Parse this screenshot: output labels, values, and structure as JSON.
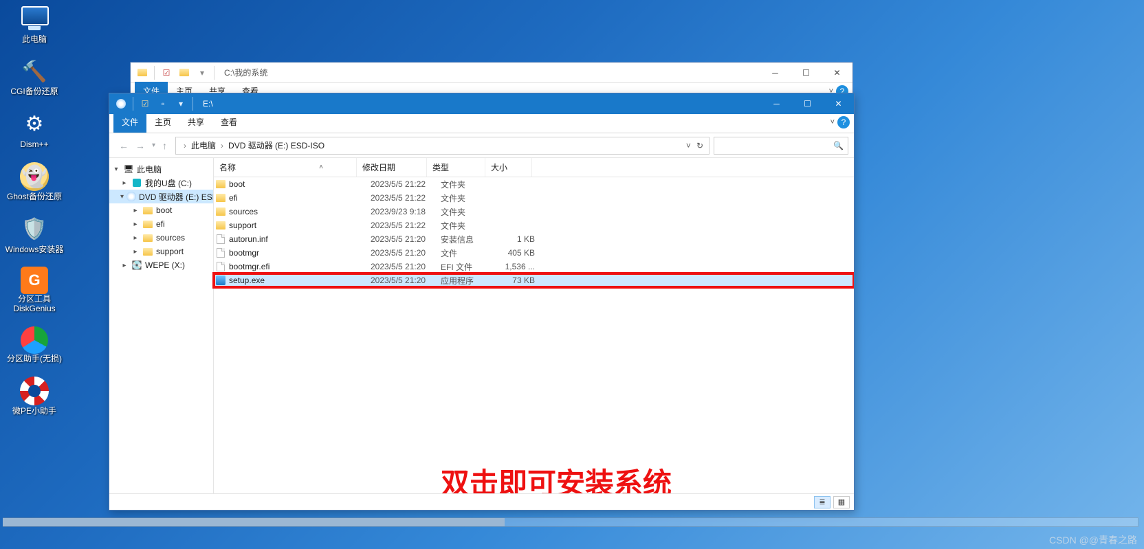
{
  "desktop": {
    "icons": [
      {
        "name": "this-pc",
        "label": "此电脑"
      },
      {
        "name": "cgi-backup",
        "label": "CGI备份还原"
      },
      {
        "name": "dism-plus",
        "label": "Dism++"
      },
      {
        "name": "ghost-backup",
        "label": "Ghost备份还原"
      },
      {
        "name": "windows-install",
        "label": "Windows安装器"
      },
      {
        "name": "diskgenius",
        "label": "分区工具DiskGenius"
      },
      {
        "name": "partition-asst",
        "label": "分区助手(无损)"
      },
      {
        "name": "micro-pe",
        "label": "微PE小助手"
      }
    ]
  },
  "back_window": {
    "title_path": "C:\\我的系统",
    "tabs": {
      "file": "文件",
      "home": "主页",
      "share": "共享",
      "view": "查看"
    }
  },
  "front_window": {
    "title_path": "E:\\",
    "tabs": {
      "file": "文件",
      "home": "主页",
      "share": "共享",
      "view": "查看"
    },
    "breadcrumb": [
      "此电脑",
      "DVD 驱动器 (E:) ESD-ISO"
    ],
    "search_placeholder": "",
    "columns": {
      "name": "名称",
      "date": "修改日期",
      "type": "类型",
      "size": "大小"
    },
    "nav_tree": [
      {
        "label": "此电脑",
        "icon": "pc",
        "depth": 0,
        "expander": "▾"
      },
      {
        "label": "我的U盘 (C:)",
        "icon": "usb",
        "depth": 1,
        "expander": "▸"
      },
      {
        "label": "DVD 驱动器 (E:) ESD-ISO",
        "icon": "disc",
        "depth": 1,
        "expander": "▾",
        "selected": true
      },
      {
        "label": "boot",
        "icon": "folder",
        "depth": 2,
        "expander": "▸"
      },
      {
        "label": "efi",
        "icon": "folder",
        "depth": 2,
        "expander": "▸"
      },
      {
        "label": "sources",
        "icon": "folder",
        "depth": 2,
        "expander": "▸"
      },
      {
        "label": "support",
        "icon": "folder",
        "depth": 2,
        "expander": "▸"
      },
      {
        "label": "WEPE (X:)",
        "icon": "drive",
        "depth": 1,
        "expander": "▸"
      }
    ],
    "files": [
      {
        "name": "boot",
        "date": "2023/5/5 21:22",
        "type": "文件夹",
        "size": "",
        "icon": "folder"
      },
      {
        "name": "efi",
        "date": "2023/5/5 21:22",
        "type": "文件夹",
        "size": "",
        "icon": "folder"
      },
      {
        "name": "sources",
        "date": "2023/9/23 9:18",
        "type": "文件夹",
        "size": "",
        "icon": "folder"
      },
      {
        "name": "support",
        "date": "2023/5/5 21:22",
        "type": "文件夹",
        "size": "",
        "icon": "folder"
      },
      {
        "name": "autorun.inf",
        "date": "2023/5/5 21:20",
        "type": "安装信息",
        "size": "1 KB",
        "icon": "file"
      },
      {
        "name": "bootmgr",
        "date": "2023/5/5 21:20",
        "type": "文件",
        "size": "405 KB",
        "icon": "file"
      },
      {
        "name": "bootmgr.efi",
        "date": "2023/5/5 21:20",
        "type": "EFI 文件",
        "size": "1,536 ...",
        "icon": "file"
      },
      {
        "name": "setup.exe",
        "date": "2023/5/5 21:20",
        "type": "应用程序",
        "size": "73 KB",
        "icon": "exe",
        "selected": true,
        "highlighted": true
      }
    ]
  },
  "annotation": "双击即可安装系统",
  "watermark": "CSDN @@青春之路"
}
